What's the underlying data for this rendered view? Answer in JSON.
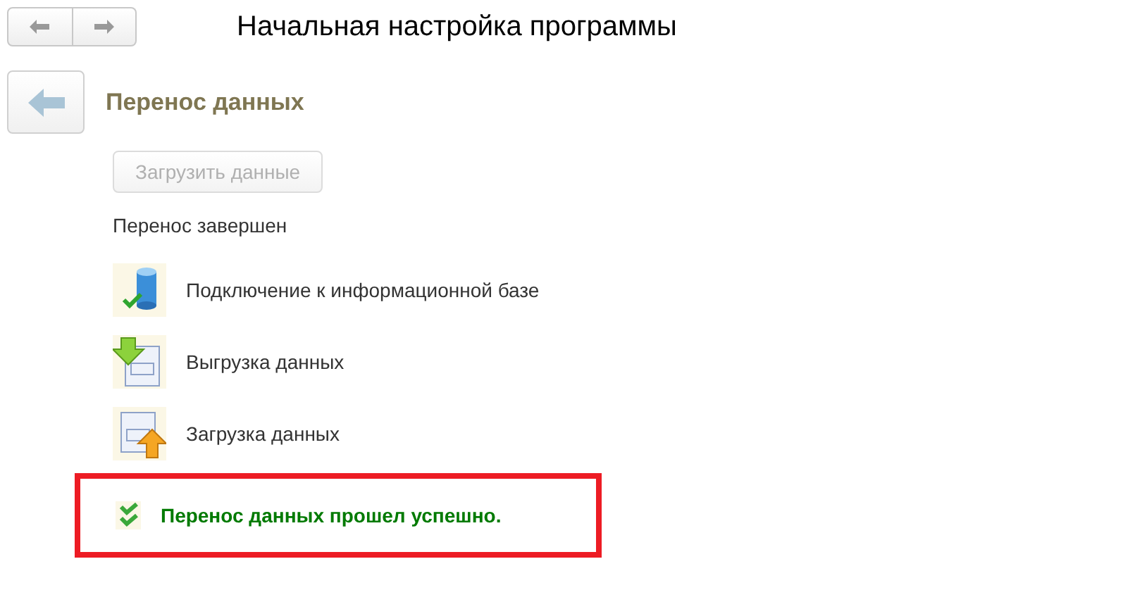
{
  "window": {
    "title": "Начальная настройка программы"
  },
  "section": {
    "title": "Перенос данных"
  },
  "load_button": {
    "label": "Загрузить данные",
    "disabled": true
  },
  "status": "Перенос завершен",
  "steps": [
    {
      "kind": "database",
      "label": "Подключение к информационной базе"
    },
    {
      "kind": "export",
      "label": "Выгрузка данных"
    },
    {
      "kind": "import",
      "label": "Загрузка данных"
    }
  ],
  "result": {
    "message": "Перенос данных прошел успешно.",
    "highlighted": true
  }
}
